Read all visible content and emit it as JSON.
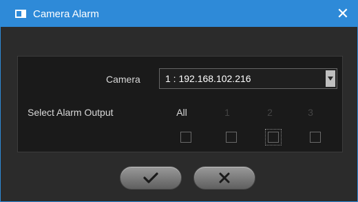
{
  "window": {
    "title": "Camera Alarm",
    "close_glyph": "✕"
  },
  "form": {
    "camera_label": "Camera",
    "camera_value": "1 : 192.168.102.216",
    "output_label": "Select Alarm Output",
    "columns": [
      "All",
      "1",
      "2",
      "3"
    ]
  },
  "buttons": {
    "ok_icon": "checkmark-icon",
    "cancel_icon": "x-icon"
  },
  "colors": {
    "title_bar": "#2e8ad8",
    "background": "#2b2b2b",
    "panel": "#1a1a1a"
  }
}
